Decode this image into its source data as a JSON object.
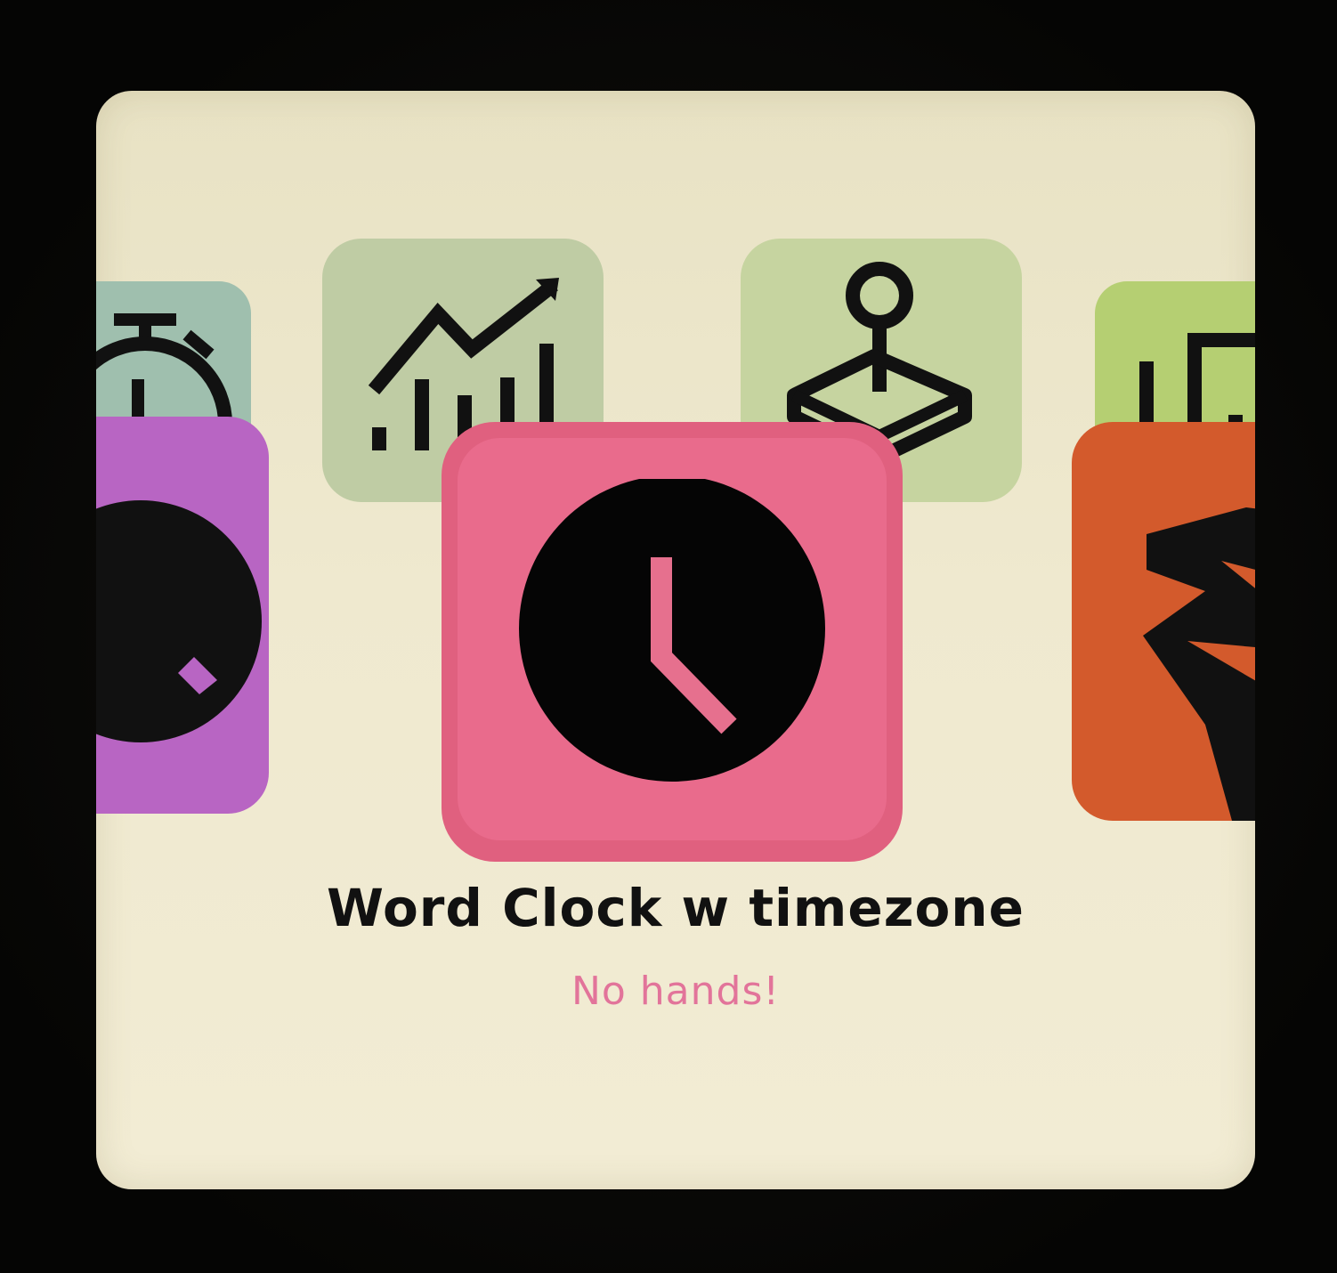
{
  "app": {
    "selected_title": "Word Clock w timezone",
    "selected_subtitle": "No hands!"
  },
  "tiles": [
    {
      "id": "back-left",
      "icon": "stopwatch-icon",
      "color": "#9fbfae"
    },
    {
      "id": "back-chart",
      "icon": "line-bar-chart-icon",
      "color": "#bfcca4"
    },
    {
      "id": "back-game",
      "icon": "joystick-icon",
      "color": "#c6d4a0"
    },
    {
      "id": "back-right",
      "icon": "chart-icon",
      "color": "#b5cf72"
    },
    {
      "id": "front-left",
      "icon": "clock-icon",
      "color": "#b865c3"
    },
    {
      "id": "front-main",
      "icon": "clock-icon",
      "color": "#e0607f",
      "inner_color": "#e96b8c",
      "hand_color": "#e6708e"
    },
    {
      "id": "front-right",
      "icon": "zigzag-icon",
      "color": "#d35a2c"
    }
  ],
  "colors": {
    "screen_bg": "#efe9cf",
    "title_text": "#111111",
    "subtitle_text": "#e2749a"
  }
}
